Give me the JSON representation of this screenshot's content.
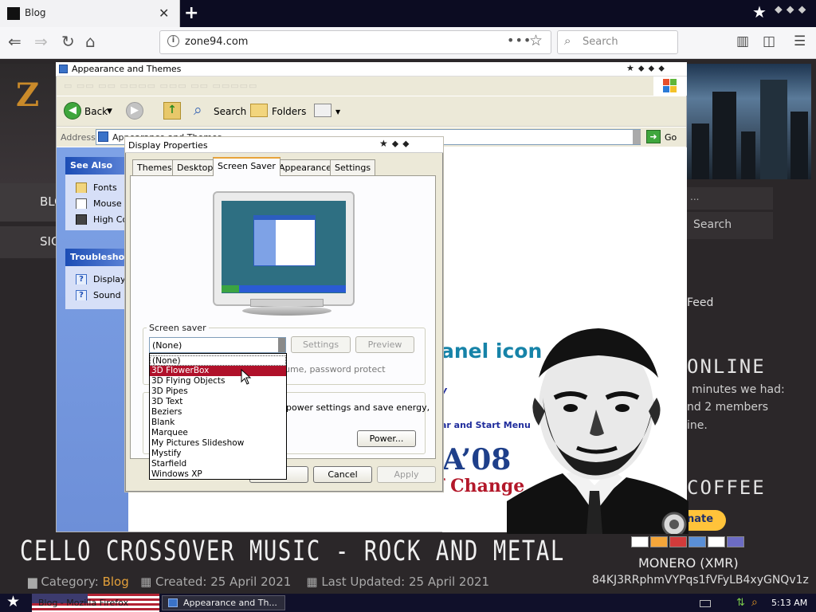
{
  "browser": {
    "tab_title": "Blog",
    "tab_close": "✕",
    "new_tab": "+",
    "url": "zone94.com",
    "search_placeholder": "Search",
    "page_actions": "•••"
  },
  "website": {
    "logo": "Z",
    "menu": [
      "BLO",
      "SIG"
    ],
    "search_button": "Search",
    "feed_label": "Feed",
    "online_heading": "ONLINE",
    "online_lines": [
      "minutes we had:",
      "nd 2 members",
      "ine."
    ],
    "coffee_heading": "COFFEE",
    "donate_label": "nate",
    "monero_label": "MONERO (XMR)",
    "monero_address": "84KJ3RRphmVYPqs1fVFyLB4xyGNQv1z",
    "article_title": "CELLO CROSSOVER MUSIC - ROCK AND METAL",
    "meta": {
      "category_label": "Category:",
      "category_value": "Blog",
      "created": "Created: 25 April 2021",
      "updated": "Last Updated: 25 April 2021"
    }
  },
  "explorer": {
    "title": "Appearance and Themes",
    "toolbar": {
      "back": "Back",
      "search": "Search",
      "folders": "Folders"
    },
    "address_label": "Address",
    "address_value": "Appearance and Themes",
    "go_label": "Go",
    "see_also": {
      "heading": "See Also",
      "items": [
        "Fonts",
        "Mouse Pointers",
        "High Contrast"
      ]
    },
    "troubleshooters": {
      "heading": "Troubleshooters",
      "items": [
        "Display",
        "Sound"
      ]
    },
    "content": {
      "heading": "anel icon",
      "link_partial": "y",
      "link_taskbar": "ar and Start Menu",
      "campaign_year": "A’08",
      "campaign_slogan": "f Change"
    }
  },
  "display_properties": {
    "title": "Display Properties",
    "tabs": [
      "Themes",
      "Desktop",
      "Screen Saver",
      "Appearance",
      "Settings"
    ],
    "active_tab": "Screen Saver",
    "screen_saver_group": "Screen saver",
    "selected_screensaver": "(None)",
    "settings_button": "Settings",
    "preview_button": "Preview",
    "password_hint": "ume, password protect",
    "power_text": "power settings and save energy,",
    "power_button": "Power...",
    "cancel_button": "Cancel",
    "apply_button": "Apply",
    "dropdown_options": [
      "(None)",
      "3D FlowerBox",
      "3D Flying Objects",
      "3D Pipes",
      "3D Text",
      "Beziers",
      "Blank",
      "Marquee",
      "My Pictures Slideshow",
      "Mystify",
      "Starfield",
      "Windows XP"
    ],
    "highlighted_option": "3D FlowerBox"
  },
  "taskbar": {
    "items": [
      "Blog - Mozilla Firefox",
      "Appearance and Th..."
    ],
    "clock": "5:13 AM"
  },
  "colors": {
    "xp_blue": "#1c4db5",
    "selection_red": "#b0112a",
    "site_accent": "#e4a13a"
  }
}
